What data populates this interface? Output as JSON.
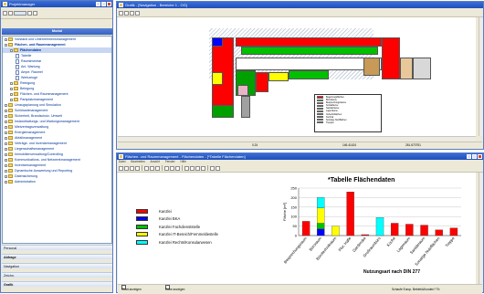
{
  "colors": {
    "red": "#ff0000",
    "blue": "#0000ff",
    "green": "#00c000",
    "yellow": "#ffff00",
    "cyan": "#00ffff",
    "titlebar": "#2e5fc8"
  },
  "left": {
    "title": "Projektmanager",
    "subheader": "Modul",
    "tree": [
      {
        "label": "Vorstand und Unternehmensmanagement",
        "indent": 0,
        "type": "folder"
      },
      {
        "label": "Flächen- und Raummanagement",
        "indent": 0,
        "type": "folder",
        "open": true
      },
      {
        "label": "Flächendaten",
        "indent": 1,
        "type": "folder",
        "open": true
      },
      {
        "label": "Tabelle",
        "indent": 2,
        "type": "doc"
      },
      {
        "label": "Rauminventar",
        "indent": 2,
        "type": "doc"
      },
      {
        "label": "Anl. Wartung",
        "indent": 2,
        "type": "doc"
      },
      {
        "label": "Ampe. Raumel",
        "indent": 2,
        "type": "doc"
      },
      {
        "label": "Werkzeuge",
        "indent": 2,
        "type": "doc"
      },
      {
        "label": "Reinigung",
        "indent": 1,
        "type": "folder"
      },
      {
        "label": "Belegung",
        "indent": 1,
        "type": "folder"
      },
      {
        "label": "Flächen- und Raummanagement",
        "indent": 1,
        "type": "folder"
      },
      {
        "label": "Parkplatzmanagement",
        "indent": 1,
        "type": "folder"
      },
      {
        "label": "Umzugsplanung und Simulation",
        "indent": 0,
        "type": "folder"
      },
      {
        "label": "Schlüsselmanagement",
        "indent": 0,
        "type": "folder"
      },
      {
        "label": "Sicherheit, Brandschutz, Umwelt",
        "indent": 0,
        "type": "folder"
      },
      {
        "label": "Instandhaltungs- und Wartungsmanagement",
        "indent": 0,
        "type": "folder"
      },
      {
        "label": "Mietvertragsverwaltung",
        "indent": 0,
        "type": "folder"
      },
      {
        "label": "Energiemanagement",
        "indent": 0,
        "type": "folder"
      },
      {
        "label": "Abfallmanagement",
        "indent": 0,
        "type": "folder"
      },
      {
        "label": "Verträge- und Inventarmanagement",
        "indent": 0,
        "type": "folder"
      },
      {
        "label": "Liegenschaftsmanagement",
        "indent": 0,
        "type": "folder"
      },
      {
        "label": "Immobilienverwaltung/Controlling",
        "indent": 0,
        "type": "folder"
      },
      {
        "label": "Kommunikations- und Netzwerkmanagement",
        "indent": 0,
        "type": "folder"
      },
      {
        "label": "Inventarmanagement",
        "indent": 0,
        "type": "folder"
      },
      {
        "label": "Dynamische Auswertung und Reporting",
        "indent": 0,
        "type": "folder"
      },
      {
        "label": "Datensicherung",
        "indent": 0,
        "type": "folder"
      },
      {
        "label": "Administration",
        "indent": 0,
        "type": "folder"
      }
    ],
    "nav": [
      "Personal",
      "Abfrage",
      "Navigation",
      "Zeichn.",
      "Grafik"
    ]
  },
  "top": {
    "title": "Grafik - [Navigation - Bereiche 1 - OG]",
    "plan_legend": [
      {
        "label": "Begehungsflächen",
        "color": "#ff0000"
      },
      {
        "label": "Büroräume",
        "color": "#ffffff"
      },
      {
        "label": "Besprechungsräume",
        "color": "#ffff00"
      },
      {
        "label": "Sozialräume",
        "color": "#00a000"
      },
      {
        "label": "Sanitärräume",
        "color": "#e9b4c8"
      },
      {
        "label": "Lagerräume",
        "color": "#00ffff"
      },
      {
        "label": "Verkehrsflächen",
        "color": "#a0a0a0"
      },
      {
        "label": "Technik",
        "color": "#ffc000"
      },
      {
        "label": "Sonstige Nutzflächen",
        "color": "#00c000"
      },
      {
        "label": "Treppen",
        "color": "#9aa0ff"
      }
    ],
    "status": [
      "0.24",
      "146.41424",
      "261.670751"
    ]
  },
  "bottom": {
    "title": "Flächen- und Raummanagement - Flächendaten - [*Tabelle Flächendaten]",
    "menu": [
      "Datei",
      "Bearbeiten",
      "Ansicht",
      "Fenster",
      "Hilfe"
    ],
    "legend": [
      {
        "label": "Kanzlei",
        "color": "#ff0000"
      },
      {
        "label": "Kanzlei BKA",
        "color": "#0000ff"
      },
      {
        "label": "Kanzlei Fachdienststelle",
        "color": "#00c000"
      },
      {
        "label": "Kanzlei IT-Bereich/Fernmeldestelle",
        "color": "#ffff00"
      },
      {
        "label": "Kanzlei Rechts/Konsularwesen",
        "color": "#00ffff"
      }
    ],
    "checkbox_chart": "Chart anzeigen",
    "checkbox_cube": "Cube anzeigen",
    "footer": "Schaufe Europ. Betrieb&Kunden? Tb"
  },
  "chart_data": {
    "type": "bar",
    "stacked": true,
    "title": "*Tabelle Flächendaten",
    "ylabel": "Fläche [m²]",
    "xlabel": "Nutzungsart nach DIN 277",
    "ylim": [
      0,
      250
    ],
    "yticks": [
      0,
      50,
      100,
      150,
      200,
      250
    ],
    "categories": [
      "Besprechungsraum",
      "Büroraum",
      "Bürotechnikraum",
      "Flur, Halle",
      "Garderobe",
      "Großraumbüro",
      "Küche",
      "Lagerraum",
      "Sanitärraum",
      "Sonstige Nutzflächen",
      "Treppe"
    ],
    "series": [
      {
        "name": "Kanzlei",
        "color": "#ff0000",
        "values": [
          75,
          0,
          0,
          230,
          5,
          0,
          65,
          60,
          55,
          30,
          40
        ]
      },
      {
        "name": "Kanzlei BKA",
        "color": "#0000ff",
        "values": [
          0,
          35,
          0,
          0,
          0,
          0,
          0,
          0,
          0,
          0,
          0
        ]
      },
      {
        "name": "Kanzlei Fachdienststelle",
        "color": "#00c000",
        "values": [
          0,
          30,
          0,
          0,
          0,
          0,
          0,
          0,
          0,
          0,
          0
        ]
      },
      {
        "name": "Kanzlei IT-Bereich/Fernmeldestelle",
        "color": "#ffff00",
        "values": [
          0,
          80,
          50,
          0,
          0,
          0,
          0,
          0,
          0,
          0,
          0
        ]
      },
      {
        "name": "Kanzlei Rechts/Konsularwesen",
        "color": "#00ffff",
        "values": [
          0,
          55,
          0,
          0,
          0,
          95,
          0,
          0,
          0,
          0,
          0
        ]
      }
    ]
  }
}
